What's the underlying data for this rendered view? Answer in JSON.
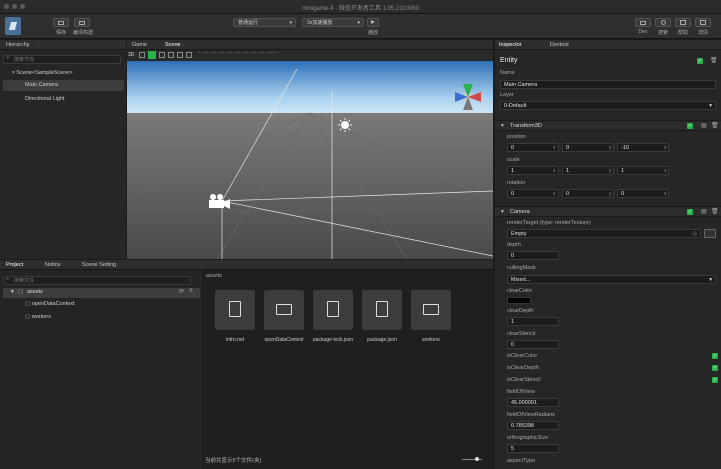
{
  "window": {
    "title": "minigame-II - 微信开发者工具 1.05.2110050"
  },
  "toolbar": {
    "left_buttons": [
      {
        "label": "保存",
        "icon": "save-icon"
      },
      {
        "label": "编译构建",
        "icon": "build-icon"
      }
    ],
    "dropdown1": "普通运行",
    "dropdown2": "3x加速播放",
    "play_label": "播放",
    "right_buttons": [
      {
        "label": "Dev",
        "icon": "dev-icon"
      },
      {
        "label": "搜索",
        "icon": "search-icon"
      },
      {
        "label": "帮助",
        "icon": "help-icon"
      },
      {
        "label": "详情",
        "icon": "detail-icon"
      }
    ]
  },
  "hierarchy": {
    "tab": "Hierarchy",
    "search_placeholder": "搜索节点",
    "items": [
      {
        "label": "Scene<SampleScene>"
      },
      {
        "label": "Main Camera"
      },
      {
        "label": "Directional Light"
      }
    ]
  },
  "scene_tabs": {
    "game": "Game",
    "scene": "Scene",
    "mode": "3D"
  },
  "project": {
    "tabs": [
      "Project",
      "Notice",
      "Scene Setting"
    ],
    "search_placeholder": "搜索文件",
    "root": "assets",
    "children": [
      "openDataContext",
      "workers"
    ],
    "path": "assets",
    "files": [
      {
        "name": "intro.md",
        "icon": "document-icon"
      },
      {
        "name": "openDataContext",
        "icon": "folder-icon"
      },
      {
        "name": "package-lock.json",
        "icon": "document-icon"
      },
      {
        "name": "package.json",
        "icon": "document-icon"
      },
      {
        "name": "workers",
        "icon": "folder-icon"
      }
    ],
    "status": "当前共显示5个文件(夹)"
  },
  "inspector": {
    "tabs": [
      "Inspector",
      "Devtool"
    ],
    "entity": "Entity",
    "name_label": "Name",
    "name_value": "Main Camera",
    "layer_label": "Layer",
    "layer_value": "0-Default",
    "transform": {
      "title": "Transform3D",
      "position_label": "position",
      "position": [
        "0",
        "0",
        "-10"
      ],
      "scale_label": "scale",
      "scale": [
        "1",
        "1",
        "1"
      ],
      "rotation_label": "rotation",
      "rotation": [
        "0",
        "0",
        "0"
      ]
    },
    "camera": {
      "title": "Camera",
      "rt_label": "renderTarget (type: renderTexture)",
      "rt_value": "Empty",
      "depth_label": "depth",
      "depth_value": "0",
      "mask_label": "cullingMask",
      "mask_value": "Mixed...",
      "clear_color_label": "clearColor",
      "clear_color": "#000000",
      "clear_depth_label": "clearDepth",
      "clear_depth_value": "1",
      "clear_stencil_label": "clearStencil",
      "clear_stencil_value": "0",
      "is_clear_color": "isClearColor",
      "is_clear_depth": "isClearDepth",
      "is_clear_stencil": "isClearStencil",
      "fov_label": "fieldOfView",
      "fov_value": "45.000001",
      "fovr_label": "fieldOfViewRadians",
      "fovr_value": "0.785398",
      "ortho_label": "orthographicSize",
      "ortho_value": "5",
      "aspect_label": "aspectType"
    }
  },
  "axes": {
    "x": "x",
    "y": "y",
    "z": "z"
  },
  "colors": {
    "accent": "#2bb24c",
    "sky": "#a9d1ef",
    "ground": "#5a5a5a"
  }
}
